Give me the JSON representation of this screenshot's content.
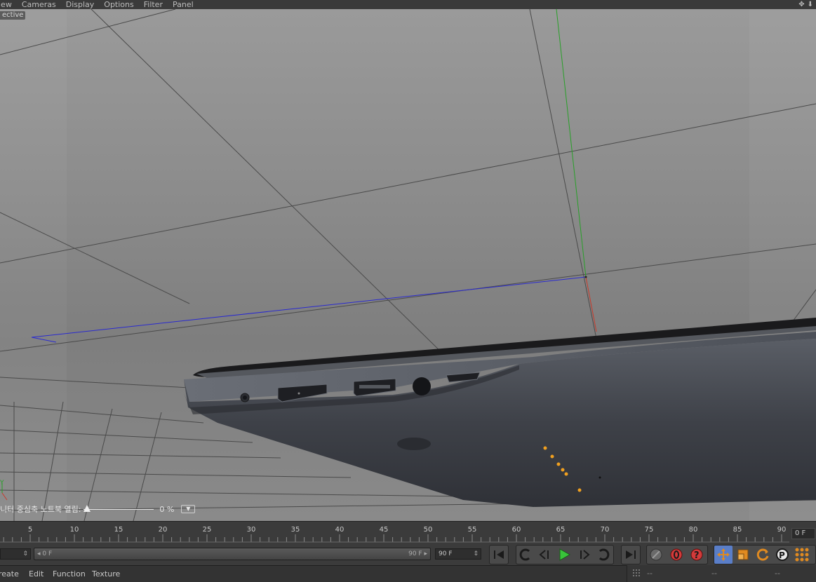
{
  "viewport_menu": {
    "items": [
      "iew",
      "Cameras",
      "Display",
      "Options",
      "Filter",
      "Panel"
    ]
  },
  "viewport": {
    "camera_label": "ective",
    "hud_label": "니터 중심축 노트북 열림:",
    "hud_value": "0 %",
    "hud_slider_fraction": 0.0
  },
  "timeline": {
    "ticks": [
      "5",
      "10",
      "15",
      "20",
      "25",
      "30",
      "35",
      "40",
      "45",
      "50",
      "55",
      "60",
      "65",
      "70",
      "75",
      "80",
      "85",
      "90"
    ],
    "current_frame": "0 F"
  },
  "transport": {
    "range_start": "0 F",
    "range_end": "90 F",
    "end_field": "90 F"
  },
  "bottom_menu": {
    "items": [
      "reate",
      "Edit",
      "Function",
      "Texture"
    ]
  },
  "coords": {
    "values": [
      "--",
      "--",
      "--"
    ]
  },
  "colors": {
    "accent_play": "#39c43a",
    "record_red": "#d23a3a",
    "axis_x": "#c83a2a",
    "axis_y": "#28a028",
    "axis_z": "#2a2ad0",
    "led_orange": "#f0a020",
    "mode_blue": "#4a7ad0"
  }
}
